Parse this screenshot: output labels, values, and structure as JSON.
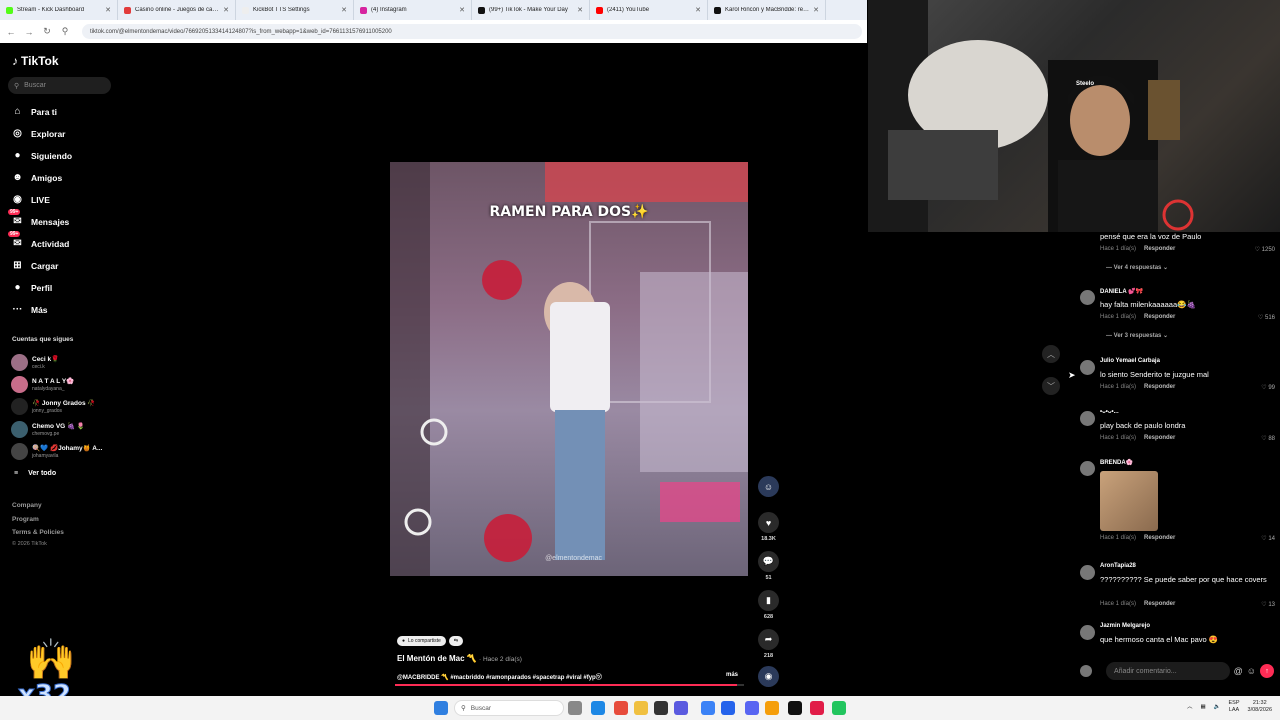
{
  "browser": {
    "tabs": [
      {
        "title": "Stream - Kick Dashboard",
        "color": "#53fc18"
      },
      {
        "title": "Casino online - Juegos de casino",
        "color": "#e23b3b"
      },
      {
        "title": "KickBot TTS Settings",
        "color": "#eeeeee"
      },
      {
        "title": "(4) Instagram",
        "color": "#d6249f"
      },
      {
        "title": "(99+) TikTok - Make Your Day",
        "color": "#111111"
      },
      {
        "title": "(2411) YouTube",
        "color": "#ff0000"
      },
      {
        "title": "Karol Rincón y MacBridde: relación",
        "color": "#111111"
      }
    ],
    "url": "tiktok.com/@elmentondemac/video/7669205133414124807?is_from_webapp=1&web_id=7661131576911005200"
  },
  "sidebar": {
    "logo": "TikTok",
    "search_placeholder": "Buscar",
    "nav": [
      {
        "label": "Para ti",
        "icon": "home-icon",
        "glyph": "⌂"
      },
      {
        "label": "Explorar",
        "icon": "compass-icon",
        "glyph": "◎"
      },
      {
        "label": "Siguiendo",
        "icon": "following-icon",
        "glyph": "●"
      },
      {
        "label": "Amigos",
        "icon": "friends-icon",
        "glyph": "☻"
      },
      {
        "label": "LIVE",
        "icon": "live-icon",
        "glyph": "◉"
      },
      {
        "label": "Mensajes",
        "icon": "messages-icon",
        "glyph": "✉",
        "badge": "99+"
      },
      {
        "label": "Actividad",
        "icon": "activity-icon",
        "glyph": "✉",
        "badge": "99+"
      },
      {
        "label": "Cargar",
        "icon": "upload-icon",
        "glyph": "⊞"
      },
      {
        "label": "Perfil",
        "icon": "profile-icon",
        "glyph": "●"
      },
      {
        "label": "Más",
        "icon": "more-icon",
        "glyph": "···"
      }
    ],
    "following_title": "Cuentas que sigues",
    "following": [
      {
        "name": "Ceci k🌹",
        "handle": "ceci.k",
        "color": "#9c6f86"
      },
      {
        "name": "N A T A L Y🌸",
        "handle": "natalydayana_",
        "color": "#c86d8a"
      },
      {
        "name": "🥀 Jonny Grados 🥀",
        "handle": "jonny_grados",
        "color": "#222222"
      },
      {
        "name": "Chemo VG 🍇 🌷",
        "handle": "chemovg.pe",
        "color": "#3b5f6e"
      },
      {
        "name": "🍭💙 💋Johamy🍯 A...",
        "handle": "johamyavila",
        "color": "#444444"
      }
    ],
    "see_all": "Ver todo",
    "footer": [
      "Company",
      "Program",
      "Terms & Policies"
    ],
    "copyright": "© 2026 TikTok"
  },
  "video": {
    "overlay_text": "RAMEN PARA DOS✨",
    "watermark": "@elmentondemac",
    "likes": "18.3K",
    "comments": "51",
    "saves": "628",
    "shares": "218",
    "shared_pill": "Lo compartiste",
    "author": "El Mentón de Mac 〽️",
    "posted": "· Hace 2 día(s)",
    "description": "@MACBRIDDE 〽️ #macbriddo #ramonparados #spacetrap #viral #fyp㋡",
    "more": "más",
    "progress": 0.98
  },
  "webcam": {
    "tag": "Steelo"
  },
  "comments": [
    {
      "user": "",
      "text": "pensé que era la voz de Paulo",
      "time": "Hace 1 día(s)",
      "reply": "Responder",
      "likes": "1250",
      "more_replies": "Ver 4 respuestas"
    },
    {
      "user": "DANIELA 💕🎀",
      "text": "hay falta milenkaaaaaa😂🍇",
      "time": "Hace 1 día(s)",
      "reply": "Responder",
      "likes": "516",
      "more_replies": "Ver 3 respuestas"
    },
    {
      "user": "Julio Yemael Carbaja",
      "text": "lo siento Senderito te juzgue mal",
      "time": "Hace 1 día(s)",
      "reply": "Responder",
      "likes": "99"
    },
    {
      "user": "•ᴗ•ᴗ•...",
      "text": "play back de paulo londra",
      "time": "Hace 1 día(s)",
      "reply": "Responder",
      "likes": "88"
    },
    {
      "user": "BRENDA🌸",
      "text": "",
      "time": "Hace 1 día(s)",
      "reply": "Responder",
      "likes": "14"
    },
    {
      "user": "AronTapia28",
      "text": "?????????? Se puede saber por que hace covers",
      "time": "Hace 1 día(s)",
      "reply": "Responder",
      "likes": "13"
    },
    {
      "user": "Jazmin Melgarejo",
      "text": "que hermoso canta el Mac pavo 😍",
      "time": "",
      "reply": "",
      "likes": ""
    }
  ],
  "add_comment_placeholder": "Añadir comentario...",
  "overlay_badge": "x32",
  "taskbar": {
    "search": "Buscar",
    "lang": "ESP\nLAA",
    "time": "21:32",
    "date": "3/08/2026"
  }
}
